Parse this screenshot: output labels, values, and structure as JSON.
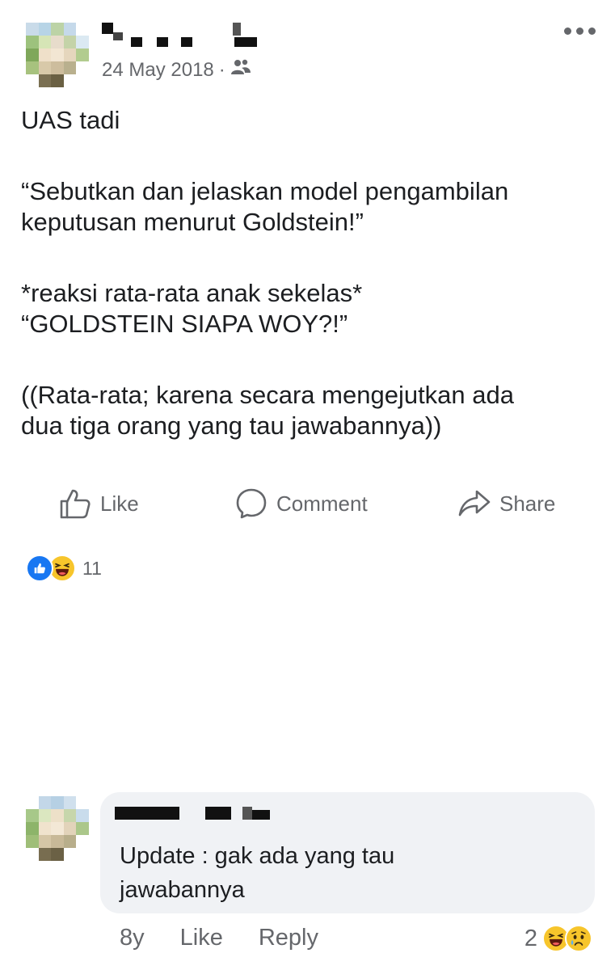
{
  "post": {
    "date": "24 May 2018",
    "privacy_separator": "·",
    "audience_icon": "friends-icon",
    "paragraphs": [
      [
        "UAS tadi"
      ],
      [
        "“Sebutkan dan jelaskan model pengambilan",
        "keputusan menurut Goldstein!”"
      ],
      [
        "*reaksi rata-rata anak sekelas*",
        "“GOLDSTEIN SIAPA WOY?!”"
      ],
      [
        "((Rata-rata; karena secara mengejutkan ada",
        "dua tiga orang yang tau jawabannya))"
      ]
    ]
  },
  "actions": {
    "like": "Like",
    "comment": "Comment",
    "share": "Share"
  },
  "reactions": {
    "icons": [
      "like-reaction-icon",
      "haha-reaction-icon"
    ],
    "count": "11"
  },
  "comment": {
    "text_line1": "Update : gak ada yang tau",
    "text_line2": "jawabannya",
    "age": "8y",
    "like": "Like",
    "reply": "Reply",
    "reaction_count": "2",
    "reaction_icons": [
      "haha-reaction-icon",
      "sad-reaction-icon"
    ]
  },
  "colors": {
    "accent": "#1877f2",
    "text": "#1c1e21",
    "muted": "#65676b",
    "bubble": "#f0f2f5"
  }
}
